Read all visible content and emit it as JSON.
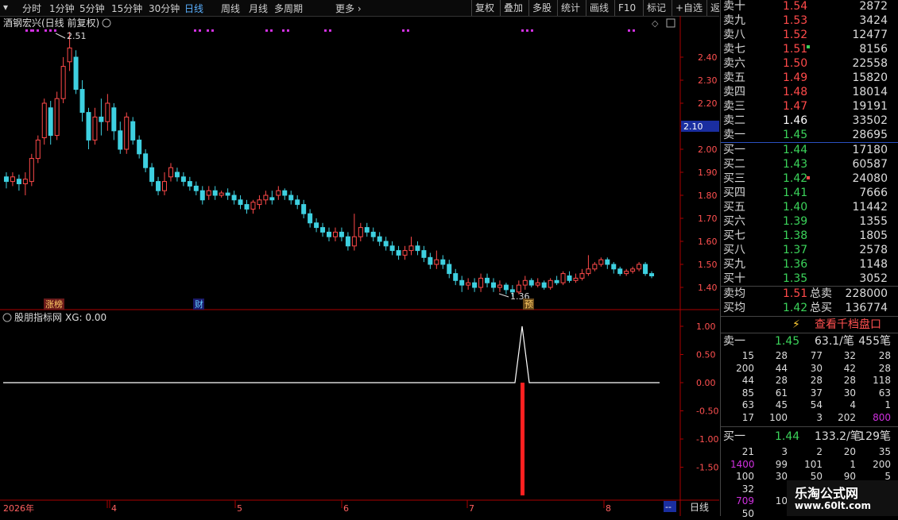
{
  "toolbar": {
    "periods": [
      "分时",
      "1分钟",
      "5分钟",
      "15分钟",
      "30分钟",
      "日线",
      "周线",
      "月线",
      "多周期",
      "更多"
    ],
    "active": "日线",
    "right_buttons": [
      "复权",
      "叠加",
      "多股",
      "统计",
      "画线",
      "F10",
      "标记",
      "+自选",
      "返回"
    ]
  },
  "stock": {
    "title": "酒钢宏兴(日线 前复权)"
  },
  "price_axis": [
    "2.40",
    "2.30",
    "2.20",
    "2.10",
    "2.00",
    "1.90",
    "1.80",
    "1.70",
    "1.60",
    "1.50",
    "1.40"
  ],
  "price_tag": "2.10",
  "high_label": "2.51",
  "low_label": "1.36",
  "markers": {
    "zhangbang": "涨榜",
    "cai": "财",
    "yu": "预"
  },
  "indicator": {
    "title": "股朋指标网",
    "xg_label": "XG: 0.00",
    "axis": [
      "1.00",
      "0.50",
      "0.00",
      "-0.50",
      "-1.00",
      "-1.50"
    ]
  },
  "time_axis": {
    "year": "2026年",
    "months": [
      "4",
      "5",
      "6",
      "7",
      "8"
    ],
    "period_label": "日线",
    "more": "--"
  },
  "orderbook": {
    "asks": [
      {
        "label": "卖十",
        "price": "1.54",
        "vol": "2872",
        "dir": "up"
      },
      {
        "label": "卖九",
        "price": "1.53",
        "vol": "3424",
        "dir": "up"
      },
      {
        "label": "卖八",
        "price": "1.52",
        "vol": "12477",
        "dir": "up"
      },
      {
        "label": "卖七",
        "price": "1.51",
        "vol": "8156",
        "dir": "up"
      },
      {
        "label": "卖六",
        "price": "1.50",
        "vol": "22558",
        "dir": "up"
      },
      {
        "label": "卖五",
        "price": "1.49",
        "vol": "15820",
        "dir": "up"
      },
      {
        "label": "卖四",
        "price": "1.48",
        "vol": "18014",
        "dir": "up"
      },
      {
        "label": "卖三",
        "price": "1.47",
        "vol": "19191",
        "dir": "up"
      },
      {
        "label": "卖二",
        "price": "1.46",
        "vol": "33502",
        "dir": "flat"
      },
      {
        "label": "卖一",
        "price": "1.45",
        "vol": "28695",
        "dir": "down"
      }
    ],
    "bids": [
      {
        "label": "买一",
        "price": "1.44",
        "vol": "17180",
        "dir": "down"
      },
      {
        "label": "买二",
        "price": "1.43",
        "vol": "60587",
        "dir": "down"
      },
      {
        "label": "买三",
        "price": "1.42",
        "vol": "24080",
        "dir": "down"
      },
      {
        "label": "买四",
        "price": "1.41",
        "vol": "7666",
        "dir": "down"
      },
      {
        "label": "买五",
        "price": "1.40",
        "vol": "11442",
        "dir": "down"
      },
      {
        "label": "买六",
        "price": "1.39",
        "vol": "1355",
        "dir": "down"
      },
      {
        "label": "买七",
        "price": "1.38",
        "vol": "1805",
        "dir": "down"
      },
      {
        "label": "买八",
        "price": "1.37",
        "vol": "2578",
        "dir": "down"
      },
      {
        "label": "买九",
        "price": "1.36",
        "vol": "1148",
        "dir": "down"
      },
      {
        "label": "买十",
        "price": "1.35",
        "vol": "3052",
        "dir": "down"
      }
    ],
    "avg_sell": {
      "label": "卖均",
      "price": "1.51",
      "total_label": "总卖",
      "total": "228000"
    },
    "avg_buy": {
      "label": "买均",
      "price": "1.42",
      "total_label": "总买",
      "total": "136774"
    },
    "level_btn": "查看千档盘口",
    "sell1": {
      "label": "卖一",
      "price": "1.45",
      "per": "63.1/笔",
      "count": "455笔"
    },
    "sell1_ticks": [
      [
        "15",
        "28",
        "77",
        "32",
        "28"
      ],
      [
        "200",
        "44",
        "30",
        "42",
        "28"
      ],
      [
        "44",
        "28",
        "28",
        "28",
        "118"
      ],
      [
        "85",
        "61",
        "37",
        "30",
        "63"
      ],
      [
        "63",
        "45",
        "54",
        "4",
        "1"
      ],
      [
        "17",
        "100",
        "3",
        "202",
        "800"
      ]
    ],
    "buy1": {
      "label": "买一",
      "price": "1.44",
      "per": "133.2/笔",
      "count": "129笔"
    },
    "buy1_ticks": [
      [
        "21",
        "3",
        "2",
        "20",
        "35"
      ],
      [
        "1400",
        "99",
        "101",
        "1",
        "200"
      ],
      [
        "100",
        "30",
        "50",
        "90",
        "5"
      ],
      [
        "32",
        "",
        "",
        "",
        ""
      ],
      [
        "709",
        "10",
        "",
        "",
        ""
      ],
      [
        "50",
        "",
        "",
        "",
        ""
      ]
    ]
  },
  "watermark": {
    "line1": "乐淘公式网",
    "line2": "www.60lt.com"
  },
  "colors": {
    "up": "#ff4a4a",
    "down": "#3bd35a",
    "accent": "#5ab0ff",
    "magenta": "#d030e0"
  }
}
